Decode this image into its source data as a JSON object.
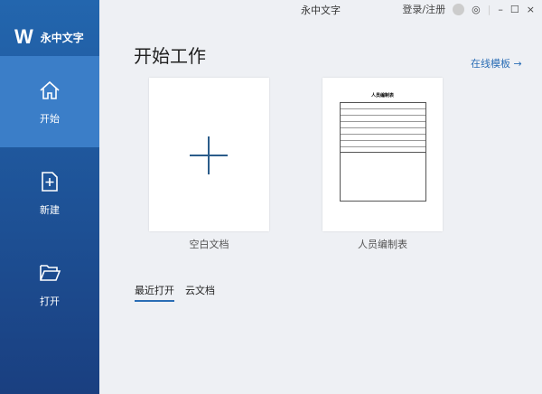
{
  "app": {
    "title": "永中文字",
    "logo_text": "永中文字",
    "logo_letter": "W"
  },
  "window": {
    "login": "登录/注册"
  },
  "sidebar": {
    "items": [
      {
        "label": "开始",
        "icon": "home-icon"
      },
      {
        "label": "新建",
        "icon": "new-file-icon"
      },
      {
        "label": "打开",
        "icon": "folder-open-icon"
      }
    ]
  },
  "main": {
    "heading": "开始工作",
    "online_templates": "在线模板 →",
    "cards": [
      {
        "label": "空白文档"
      },
      {
        "label": "人员编制表",
        "doc_title": "人员编制表"
      }
    ],
    "tabs": [
      {
        "label": "最近打开"
      },
      {
        "label": "云文档"
      }
    ]
  }
}
